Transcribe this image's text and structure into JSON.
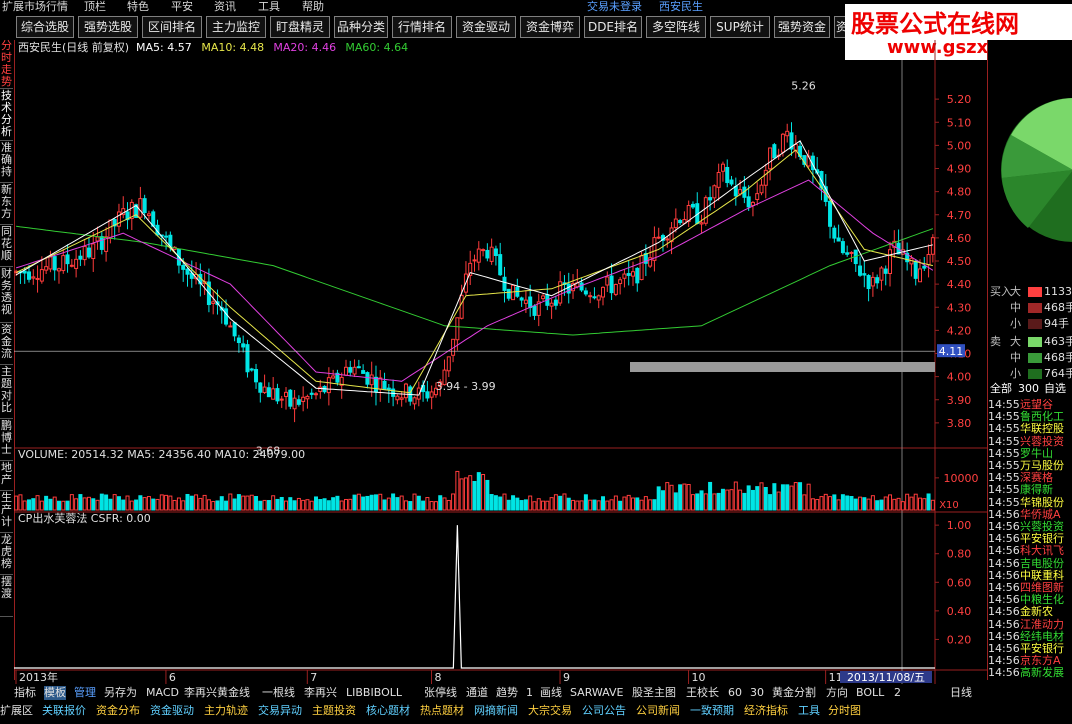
{
  "menu": {
    "items": [
      "扩展市场行情",
      "顶栏",
      "特色",
      "平安",
      "资讯",
      "工具",
      "帮助"
    ],
    "trade_status": "交易未登录",
    "stock_name": "西安民生"
  },
  "tabs": [
    "综合选股",
    "强势选股",
    "区间排名",
    "主力监控",
    "盯盘精灵",
    "品种分类",
    "行情排名",
    "资金驱动",
    "资金博弈",
    "DDE排名",
    "多空阵线",
    "SUP统计",
    "强势资金",
    "资"
  ],
  "watermark": {
    "title": "股票公式在线网",
    "url": "www.gszx.com.cn"
  },
  "left_tabs": [
    "分时走势",
    "技术分析",
    "准确持",
    "新东方",
    "同花顺",
    "财务透视",
    "资金流",
    "主题对比",
    "鹏博士",
    "地产",
    "生产计",
    "龙虎榜",
    "摆渡"
  ],
  "bottom_tabs": [
    "扩展区",
    "关联报价",
    "资金分布",
    "资金驱动",
    "主力轨迹",
    "交易异动",
    "主题投资",
    "核心题材",
    "热点题材",
    "网摘新闻",
    "大宗交易",
    "公司公告",
    "公司新闻",
    "一致预期",
    "经济指标",
    "工具",
    "分时图"
  ],
  "formula_tabs": [
    "指标",
    "模板",
    "管理",
    "另存为",
    "MACD",
    "李再兴黄金线",
    "一根线",
    "李再兴",
    "LIBBIBOLL",
    "张停线",
    "通道",
    "趋势",
    "1",
    "画线",
    "SARWAVE",
    "股圣主图",
    "王校长",
    "60",
    "30",
    "黄金分割",
    "方向",
    "BOLL",
    "2"
  ],
  "period_label": "日线",
  "order_book": {
    "buy_label": "买入",
    "sell_label": "卖",
    "buy": [
      {
        "level": "大",
        "qty": "1133"
      },
      {
        "level": "中",
        "qty": "468手"
      },
      {
        "level": "小",
        "qty": "94手"
      }
    ],
    "sell": [
      {
        "level": "大",
        "qty": "463手"
      },
      {
        "level": "中",
        "qty": "468手"
      },
      {
        "level": "小",
        "qty": "764手"
      }
    ],
    "summary": [
      "全部",
      "300",
      "自选"
    ]
  },
  "quotes": [
    {
      "time": "14:55",
      "name": "远望谷"
    },
    {
      "time": "14:55",
      "name": "鲁西化工"
    },
    {
      "time": "14:55",
      "name": "华联控股"
    },
    {
      "time": "14:55",
      "name": "兴蓉投资"
    },
    {
      "time": "14:55",
      "name": "罗牛山"
    },
    {
      "time": "14:55",
      "name": "万马股份"
    },
    {
      "time": "14:55",
      "name": "深赛格"
    },
    {
      "time": "14:55",
      "name": "康得新"
    },
    {
      "time": "14:55",
      "name": "华锦股份"
    },
    {
      "time": "14:56",
      "name": "华侨城A"
    },
    {
      "time": "14:56",
      "name": "兴蓉投资"
    },
    {
      "time": "14:56",
      "name": "平安银行"
    },
    {
      "time": "14:56",
      "name": "科大讯飞"
    },
    {
      "time": "14:56",
      "name": "吉电股份"
    },
    {
      "time": "14:56",
      "name": "中联重科"
    },
    {
      "time": "14:56",
      "name": "四维图新"
    },
    {
      "time": "14:56",
      "name": "中粮生化"
    },
    {
      "time": "14:56",
      "name": "金新农"
    },
    {
      "time": "14:56",
      "name": "江淮动力"
    },
    {
      "time": "14:56",
      "name": "经纬电材"
    },
    {
      "time": "14:56",
      "name": "平安银行"
    },
    {
      "time": "14:56",
      "name": "京东方A"
    },
    {
      "time": "14:56",
      "name": "高新发展"
    }
  ],
  "colors": {
    "up": "#ff3c3c",
    "down": "#00e5e5",
    "ma5": "#ffffff",
    "ma10": "#e6e64a",
    "ma20": "#e040e0",
    "ma60": "#33cc33",
    "grid": "#9a2020",
    "axis_text": "#ff4040"
  },
  "chart_data": [
    {
      "type": "candlestick",
      "title": "西安民生(日线 前复权)",
      "legend": [
        {
          "label": "MA5: 4.57",
          "color": "#ffffff"
        },
        {
          "label": "MA10: 4.48",
          "color": "#e6e64a"
        },
        {
          "label": "MA20: 4.46",
          "color": "#e040e0"
        },
        {
          "label": "MA60: 4.64",
          "color": "#33cc33"
        }
      ],
      "ylim": [
        3.7,
        5.3
      ],
      "yticks": [
        "5.20",
        "5.10",
        "5.00",
        "4.90",
        "4.80",
        "4.70",
        "4.60",
        "4.50",
        "4.40",
        "4.30",
        "4.20",
        "4.10",
        "4.00",
        "3.90",
        "3.80"
      ],
      "current_price": "4.11",
      "annotations": [
        {
          "text": "5.26",
          "x": 180,
          "y": 5.26
        },
        {
          "text": "3.68",
          "x": 55,
          "y": 3.68
        },
        {
          "text": "3.94 - 3.99",
          "x": 97,
          "y": 3.96
        }
      ],
      "month_labels": [
        {
          "text": "2013年",
          "x": 0
        },
        {
          "text": "6",
          "x": 35
        },
        {
          "text": "7",
          "x": 68
        },
        {
          "text": "8",
          "x": 97
        },
        {
          "text": "9",
          "x": 127
        },
        {
          "text": "10",
          "x": 157
        },
        {
          "text": "11",
          "x": 189
        }
      ],
      "date_label": "2013/11/08/五",
      "n_bars": 215,
      "anchors": [
        [
          0,
          4.45
        ],
        [
          10,
          4.48
        ],
        [
          18,
          4.55
        ],
        [
          25,
          4.7
        ],
        [
          30,
          4.75
        ],
        [
          36,
          4.55
        ],
        [
          42,
          4.4
        ],
        [
          48,
          4.3
        ],
        [
          54,
          4.05
        ],
        [
          58,
          3.95
        ],
        [
          64,
          3.88
        ],
        [
          70,
          3.92
        ],
        [
          74,
          3.97
        ],
        [
          78,
          4.05
        ],
        [
          84,
          3.98
        ],
        [
          90,
          3.93
        ],
        [
          95,
          3.92
        ],
        [
          99,
          3.96
        ],
        [
          103,
          4.25
        ],
        [
          106,
          4.5
        ],
        [
          110,
          4.55
        ],
        [
          116,
          4.35
        ],
        [
          122,
          4.3
        ],
        [
          128,
          4.38
        ],
        [
          136,
          4.38
        ],
        [
          144,
          4.42
        ],
        [
          150,
          4.6
        ],
        [
          155,
          4.7
        ],
        [
          160,
          4.7
        ],
        [
          165,
          4.88
        ],
        [
          168,
          4.8
        ],
        [
          172,
          4.75
        ],
        [
          176,
          4.95
        ],
        [
          180,
          5.05
        ],
        [
          184,
          4.95
        ],
        [
          188,
          4.8
        ],
        [
          192,
          4.55
        ],
        [
          196,
          4.48
        ],
        [
          200,
          4.4
        ],
        [
          205,
          4.55
        ],
        [
          210,
          4.45
        ],
        [
          214,
          4.57
        ]
      ],
      "ma_anchors": {
        "ma60": [
          [
            0,
            4.65
          ],
          [
            30,
            4.58
          ],
          [
            60,
            4.48
          ],
          [
            100,
            4.22
          ],
          [
            130,
            4.18
          ],
          [
            160,
            4.22
          ],
          [
            190,
            4.48
          ],
          [
            214,
            4.64
          ]
        ],
        "ma20": [
          [
            0,
            4.47
          ],
          [
            25,
            4.62
          ],
          [
            50,
            4.4
          ],
          [
            70,
            4.02
          ],
          [
            90,
            3.98
          ],
          [
            110,
            4.22
          ],
          [
            130,
            4.38
          ],
          [
            150,
            4.52
          ],
          [
            170,
            4.72
          ],
          [
            185,
            4.85
          ],
          [
            200,
            4.62
          ],
          [
            214,
            4.46
          ]
        ],
        "ma10": [
          [
            0,
            4.45
          ],
          [
            28,
            4.7
          ],
          [
            50,
            4.3
          ],
          [
            70,
            3.98
          ],
          [
            92,
            3.93
          ],
          [
            105,
            4.35
          ],
          [
            125,
            4.38
          ],
          [
            150,
            4.55
          ],
          [
            170,
            4.8
          ],
          [
            182,
            4.98
          ],
          [
            198,
            4.55
          ],
          [
            214,
            4.48
          ]
        ],
        "ma5": [
          [
            0,
            4.44
          ],
          [
            28,
            4.74
          ],
          [
            50,
            4.25
          ],
          [
            70,
            3.95
          ],
          [
            94,
            3.92
          ],
          [
            106,
            4.45
          ],
          [
            125,
            4.35
          ],
          [
            150,
            4.58
          ],
          [
            170,
            4.85
          ],
          [
            183,
            5.02
          ],
          [
            198,
            4.5
          ],
          [
            214,
            4.57
          ]
        ]
      }
    },
    {
      "type": "bar",
      "title": "VOLUME: 20514.32  MA5: 24356.40  MA10: 24079.00",
      "ylim": [
        0,
        14000
      ],
      "yticks": [
        "10000"
      ],
      "unit": "X10",
      "spike_at": 103
    },
    {
      "type": "line",
      "title": "CP出水芙蓉法  CSFR: 0.00",
      "ylim": [
        0,
        1.05
      ],
      "yticks": [
        "1.00",
        "0.80",
        "0.60",
        "0.40",
        "0.20"
      ],
      "spike_at": 103,
      "spike_value": 1.0
    }
  ]
}
